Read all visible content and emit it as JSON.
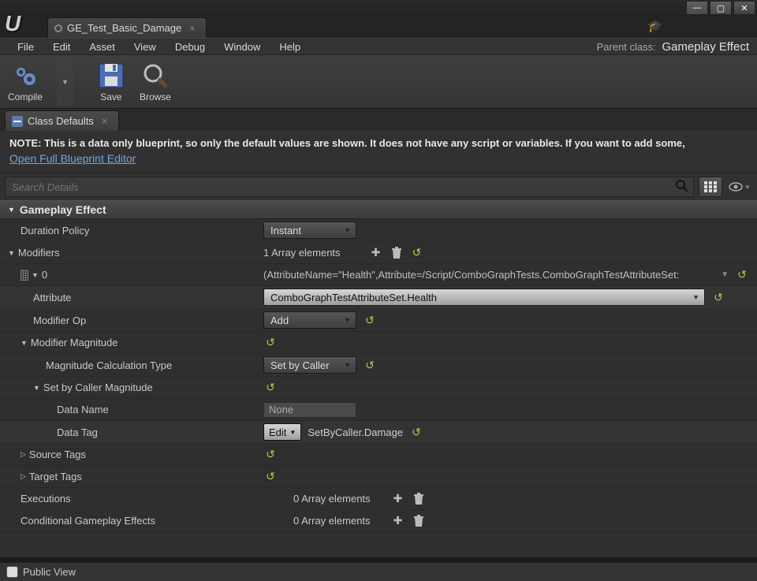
{
  "window": {
    "tab_title": "GE_Test_Basic_Damage"
  },
  "menu": {
    "items": [
      "File",
      "Edit",
      "Asset",
      "View",
      "Debug",
      "Window",
      "Help"
    ],
    "parent_label": "Parent class:",
    "parent_value": "Gameplay Effect"
  },
  "toolbar": {
    "compile": "Compile",
    "save": "Save",
    "browse": "Browse"
  },
  "panel_tab": "Class Defaults",
  "note": {
    "text": "NOTE: This is a data only blueprint, so only the default values are shown.  It does not have any script or variables.  If you want to add some,",
    "link": "Open Full Blueprint Editor"
  },
  "search_placeholder": "Search Details",
  "category": "Gameplay Effect",
  "rows": {
    "duration_policy": {
      "label": "Duration Policy",
      "value": "Instant"
    },
    "modifiers": {
      "label": "Modifiers",
      "count": "1 Array elements"
    },
    "index0": {
      "label": "0",
      "summary": "(AttributeName=\"Health\",Attribute=/Script/ComboGraphTests.ComboGraphTestAttributeSet:"
    },
    "attribute": {
      "label": "Attribute",
      "value": "ComboGraphTestAttributeSet.Health"
    },
    "modifier_op": {
      "label": "Modifier Op",
      "value": "Add"
    },
    "modifier_magnitude": {
      "label": "Modifier Magnitude"
    },
    "magnitude_calc": {
      "label": "Magnitude Calculation Type",
      "value": "Set by Caller"
    },
    "set_by_caller": {
      "label": "Set by Caller Magnitude"
    },
    "data_name": {
      "label": "Data Name",
      "value": "None"
    },
    "data_tag": {
      "label": "Data Tag",
      "edit": "Edit",
      "value": "SetByCaller.Damage"
    },
    "source_tags": {
      "label": "Source Tags"
    },
    "target_tags": {
      "label": "Target Tags"
    },
    "executions": {
      "label": "Executions",
      "count": "0 Array elements"
    },
    "conditional": {
      "label": "Conditional Gameplay Effects",
      "count": "0 Array elements"
    }
  },
  "footer": {
    "public_view": "Public View"
  }
}
